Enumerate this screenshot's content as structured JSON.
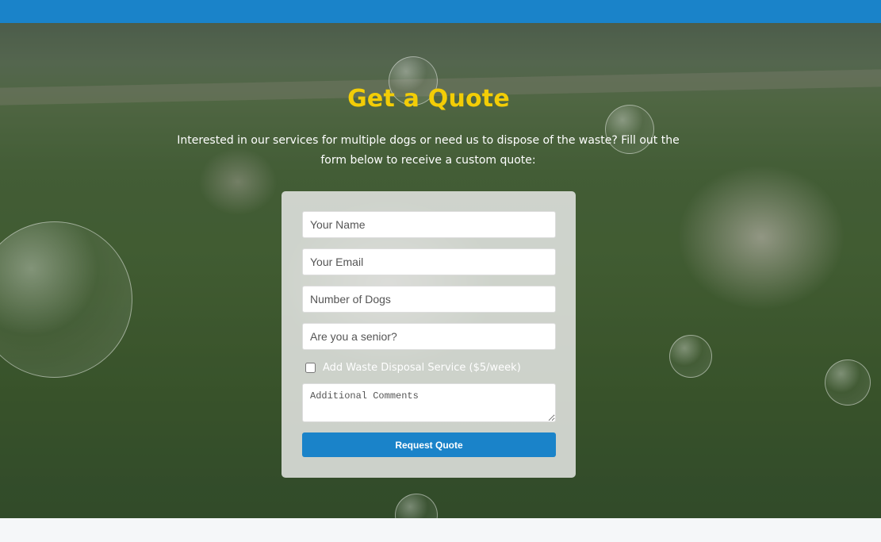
{
  "header": {
    "bar_color": "#1a83c9"
  },
  "hero": {
    "background": "photo of puppies running on grass with soap bubbles",
    "title": "Get a Quote",
    "title_color": "#f3cd06",
    "intro": "Interested in our services for multiple dogs or need us to dispose of the waste? Fill out the form below to receive a custom quote:"
  },
  "form": {
    "name_placeholder": "Your Name",
    "email_placeholder": "Your Email",
    "dogs_placeholder": "Number of Dogs",
    "senior_placeholder": "Are you a senior?",
    "waste_disposal_label": "Add Waste Disposal Service ($5/week)",
    "waste_disposal_checked": false,
    "comments_placeholder": "Additional Comments",
    "submit_label": "Request Quote",
    "button_color": "#1a83c9"
  }
}
